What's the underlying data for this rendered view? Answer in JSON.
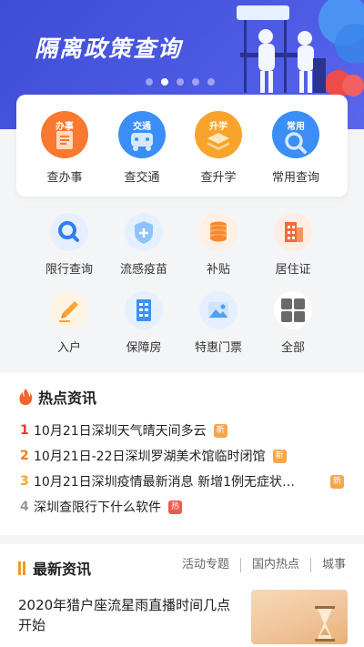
{
  "banner": {
    "title": "隔离政策查询",
    "dots": 5,
    "active_dot": 1
  },
  "services": [
    {
      "label": "查办事",
      "tag": "办事",
      "color": "#f8792f",
      "icon": "document-icon"
    },
    {
      "label": "查交通",
      "tag": "交通",
      "color": "#3a8ef6",
      "icon": "bus-icon"
    },
    {
      "label": "查升学",
      "tag": "升学",
      "color": "#f8a42c",
      "icon": "layers-icon"
    },
    {
      "label": "常用查询",
      "tag": "常用",
      "color": "#3a8ef6",
      "icon": "search-icon"
    }
  ],
  "grid": [
    {
      "label": "限行查询",
      "icon": "search-icon",
      "bg": "#e5f0ff",
      "fg": "#2f7ef0"
    },
    {
      "label": "流感疫苗",
      "icon": "shield-plus-icon",
      "bg": "#e5f0ff",
      "fg": "#4fa3f5"
    },
    {
      "label": "补贴",
      "icon": "coins-icon",
      "bg": "#fff0e3",
      "fg": "#f7882a"
    },
    {
      "label": "居住证",
      "icon": "building-icon",
      "bg": "#ffece5",
      "fg": "#f36b3a"
    },
    {
      "label": "入户",
      "icon": "pencil-icon",
      "bg": "#fff3e3",
      "fg": "#f9a53a"
    },
    {
      "label": "保障房",
      "icon": "apartment-icon",
      "bg": "#e5f0ff",
      "fg": "#3e90f2"
    },
    {
      "label": "特惠门票",
      "icon": "picture-icon",
      "bg": "#e5f0ff",
      "fg": "#4ea0f0"
    },
    {
      "label": "全部",
      "icon": "grid-icon",
      "bg": "#ffffff",
      "fg": "#6a6a6a"
    }
  ],
  "hot": {
    "title": "热点资讯",
    "items": [
      {
        "num": "1",
        "text": "10月21日深圳天气晴天间多云",
        "badge": "新",
        "num_color": "#e63b2e",
        "badge_color": "#f6a54a"
      },
      {
        "num": "2",
        "text": "10月21日-22日深圳罗湖美术馆临时闭馆",
        "badge": "新",
        "num_color": "#f07d23",
        "badge_color": "#f6a54a"
      },
      {
        "num": "3",
        "text": "10月21日深圳疫情最新消息 新增1例无症状…",
        "badge": "新",
        "num_color": "#f5a623",
        "badge_color": "#f6a54a"
      },
      {
        "num": "4",
        "text": "深圳查限行下什么软件",
        "badge": "热",
        "num_color": "#999999",
        "badge_color": "#ef5a4f"
      }
    ]
  },
  "news": {
    "title": "最新资讯",
    "tabs": [
      "活动专题",
      "国内热点",
      "城事"
    ],
    "item_text": "2020年猎户座流星雨直播时间几点开始"
  }
}
